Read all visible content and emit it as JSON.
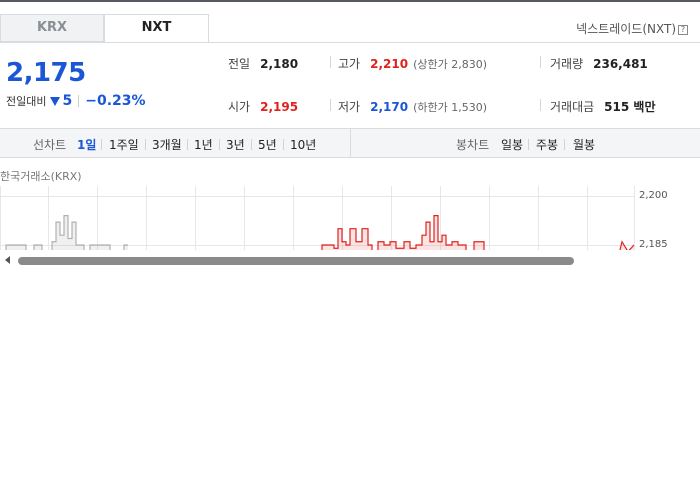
{
  "market_tabs": {
    "krx": "KRX",
    "nxt": "NXT",
    "active": "NXT"
  },
  "market_name": "넥스트레이드(NXT)",
  "help_icon": "?",
  "price": {
    "current": "2,175",
    "change_label": "전일대비",
    "change_direction": "down",
    "change_value": "5",
    "change_percent": "−0.23%"
  },
  "stats": {
    "prev_close": {
      "label": "전일",
      "value": "2,180"
    },
    "high": {
      "label": "고가",
      "value": "2,210",
      "sub": "(상한가 2,830)"
    },
    "volume": {
      "label": "거래량",
      "value": "236,481"
    },
    "open": {
      "label": "시가",
      "value": "2,195"
    },
    "low": {
      "label": "저가",
      "value": "2,170",
      "sub": "(하한가 1,530)"
    },
    "amount": {
      "label": "거래대금",
      "value": "515 백만"
    }
  },
  "period_bar": {
    "line_chart_label": "선차트",
    "line_items": [
      "1일",
      "1주일",
      "3개월",
      "1년",
      "3년",
      "5년",
      "10년"
    ],
    "active": "1일",
    "candle_chart_label": "봉차트",
    "candle_items": [
      "일봉",
      "주봉",
      "월봉"
    ]
  },
  "exchange_label": "한국거래소(KRX)",
  "chart_data": {
    "type": "line",
    "title": "",
    "y_ticks": [
      "2,200",
      "2,185"
    ],
    "ylim": [
      2181,
      2201
    ],
    "series": [
      {
        "color": "#b0b0b0",
        "x": [
          0,
          6,
          6,
          26,
          26,
          34,
          34,
          42,
          42,
          52,
          52,
          56,
          56,
          60,
          60,
          64,
          64,
          68,
          68,
          72,
          72,
          76,
          76,
          84,
          84,
          90,
          90,
          110,
          110,
          118,
          118,
          124,
          124,
          128
        ],
        "values": [
          2181,
          2181,
          2185,
          2185,
          2183,
          2183,
          2185,
          2185,
          2181,
          2181,
          2186,
          2186,
          2192,
          2192,
          2188,
          2188,
          2194,
          2194,
          2187,
          2187,
          2192,
          2192,
          2185,
          2185,
          2181,
          2181,
          2185,
          2185,
          2182,
          2182,
          2183,
          2183,
          2185,
          2185
        ]
      },
      {
        "color": "#e0221c",
        "x": [
          318,
          322,
          322,
          334,
          334,
          338,
          338,
          342,
          342,
          346,
          346,
          350,
          350,
          356,
          356,
          362,
          362,
          368,
          368,
          372,
          372,
          378,
          378,
          384,
          384,
          390,
          390,
          396,
          396,
          404,
          404,
          410,
          410,
          416,
          416,
          422,
          422,
          426,
          426,
          430,
          430,
          434,
          434,
          438,
          438,
          442,
          442,
          446,
          446,
          452,
          452,
          458,
          458,
          466,
          466,
          474,
          474,
          484,
          484,
          490,
          618,
          622,
          622,
          628,
          628,
          634
        ],
        "values": [
          2181,
          2181,
          2185,
          2185,
          2184,
          2184,
          2190,
          2190,
          2186,
          2186,
          2185,
          2185,
          2190,
          2190,
          2186,
          2186,
          2190,
          2190,
          2185,
          2185,
          2182,
          2182,
          2186,
          2186,
          2185,
          2185,
          2186,
          2186,
          2184,
          2184,
          2186,
          2186,
          2184,
          2184,
          2185,
          2185,
          2188,
          2188,
          2192,
          2192,
          2186,
          2186,
          2194,
          2194,
          2186,
          2186,
          2188,
          2188,
          2185,
          2185,
          2186,
          2186,
          2185,
          2185,
          2183,
          2183,
          2186,
          2186,
          2182,
          2182,
          2181,
          2186,
          2186,
          2183,
          2183,
          2185
        ]
      }
    ]
  }
}
